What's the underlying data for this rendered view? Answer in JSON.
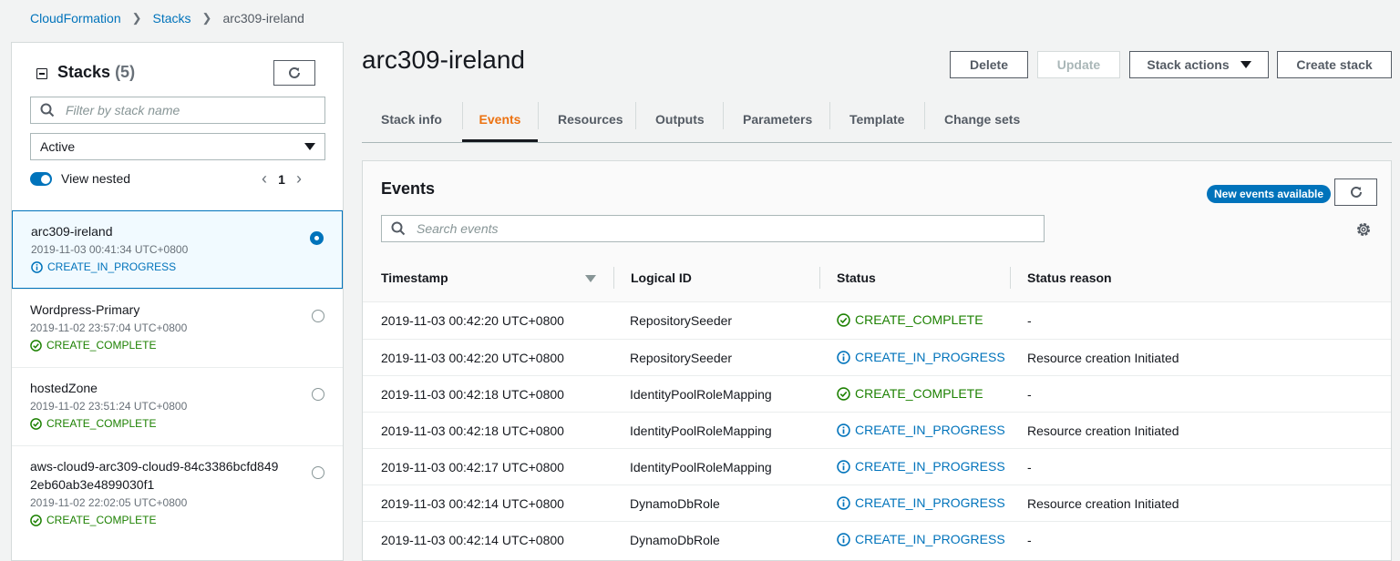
{
  "breadcrumb": {
    "items": [
      "CloudFormation",
      "Stacks"
    ],
    "current": "arc309-ireland"
  },
  "sidebar": {
    "title": "Stacks",
    "count": "(5)",
    "filter_placeholder": "Filter by stack name",
    "status_filter": "Active",
    "view_nested_label": "View nested",
    "page": "1",
    "stacks": [
      {
        "name": "arc309-ireland",
        "date": "2019-11-03 00:41:34 UTC+0800",
        "status": "CREATE_IN_PROGRESS",
        "selected": true
      },
      {
        "name": "Wordpress-Primary",
        "date": "2019-11-02 23:57:04 UTC+0800",
        "status": "CREATE_COMPLETE",
        "selected": false
      },
      {
        "name": "hostedZone",
        "date": "2019-11-02 23:51:24 UTC+0800",
        "status": "CREATE_COMPLETE",
        "selected": false
      },
      {
        "name_line1": "aws-cloud9-arc309-cloud9-84c3386bcfd849",
        "name_line2": "2eb60ab3e4899030f1",
        "date": "2019-11-02 22:02:05 UTC+0800",
        "status": "CREATE_COMPLETE",
        "selected": false
      }
    ]
  },
  "header": {
    "title": "arc309-ireland",
    "buttons": {
      "delete": "Delete",
      "update": "Update",
      "stack_actions": "Stack actions",
      "create": "Create stack"
    }
  },
  "tabs": [
    "Stack info",
    "Events",
    "Resources",
    "Outputs",
    "Parameters",
    "Template",
    "Change sets"
  ],
  "events": {
    "title": "Events",
    "badge": "New events available",
    "search_placeholder": "Search events",
    "columns": [
      "Timestamp",
      "Logical ID",
      "Status",
      "Status reason"
    ],
    "rows": [
      {
        "timestamp": "2019-11-03 00:42:20 UTC+0800",
        "logical_id": "RepositorySeeder",
        "status": "CREATE_COMPLETE",
        "reason": "-"
      },
      {
        "timestamp": "2019-11-03 00:42:20 UTC+0800",
        "logical_id": "RepositorySeeder",
        "status": "CREATE_IN_PROGRESS",
        "reason": "Resource creation Initiated"
      },
      {
        "timestamp": "2019-11-03 00:42:18 UTC+0800",
        "logical_id": "IdentityPoolRoleMapping",
        "status": "CREATE_COMPLETE",
        "reason": "-"
      },
      {
        "timestamp": "2019-11-03 00:42:18 UTC+0800",
        "logical_id": "IdentityPoolRoleMapping",
        "status": "CREATE_IN_PROGRESS",
        "reason": "Resource creation Initiated"
      },
      {
        "timestamp": "2019-11-03 00:42:17 UTC+0800",
        "logical_id": "IdentityPoolRoleMapping",
        "status": "CREATE_IN_PROGRESS",
        "reason": "-"
      },
      {
        "timestamp": "2019-11-03 00:42:14 UTC+0800",
        "logical_id": "DynamoDbRole",
        "status": "CREATE_IN_PROGRESS",
        "reason": "Resource creation Initiated"
      },
      {
        "timestamp": "2019-11-03 00:42:14 UTC+0800",
        "logical_id": "DynamoDbRole",
        "status": "CREATE_IN_PROGRESS",
        "reason": "-"
      }
    ]
  },
  "colors": {
    "link": "#0073bb",
    "success": "#1d8102",
    "active_tab": "#ec7211"
  }
}
